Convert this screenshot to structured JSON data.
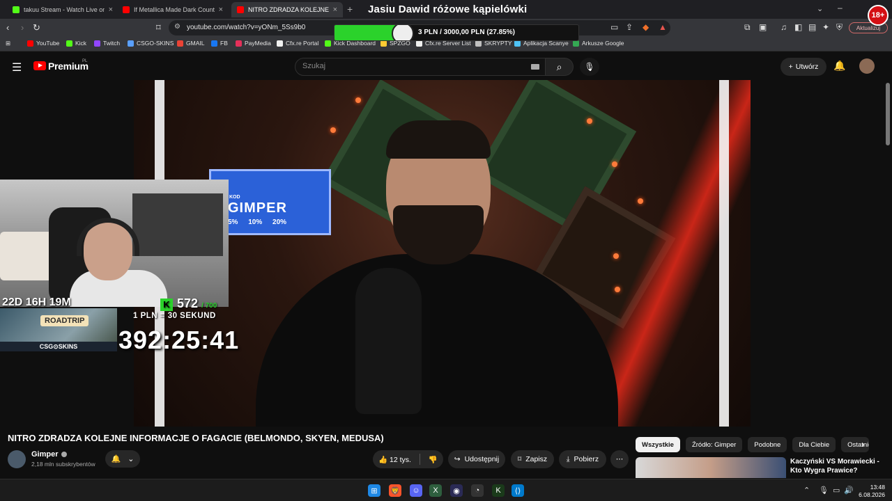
{
  "browser": {
    "tabs": [
      {
        "title": "takuu Stream - Watch Live on Kick",
        "active": false,
        "favicon_color": "#53fc18"
      },
      {
        "title": "If Metallica Made Dark Country (Sec",
        "active": false,
        "favicon_color": "#ff0000"
      },
      {
        "title": "NITRO ZDRADZA KOLEJNE IN",
        "active": true,
        "favicon_color": "#ff0000"
      }
    ],
    "new_tab": "+",
    "url": "youtube.com/watch?v=yONm_5Ss9b0",
    "update_button": "Aktualizuj",
    "bookmarks": [
      {
        "label": "YouTube",
        "color": "#ff0000"
      },
      {
        "label": "Kick",
        "color": "#53fc18"
      },
      {
        "label": "Twitch",
        "color": "#9146ff"
      },
      {
        "label": "CSGO-SKINS",
        "color": "#5aa0ff"
      },
      {
        "label": "GMAIL",
        "color": "#ea4335"
      },
      {
        "label": "FB",
        "color": "#1877f2"
      },
      {
        "label": "PayMedia",
        "color": "#e5305a"
      },
      {
        "label": "Cfx.re Portal",
        "color": "#f0f0f0"
      },
      {
        "label": "Kick Dashboard",
        "color": "#53fc18"
      },
      {
        "label": "SPZGO",
        "color": "#ffcc33"
      },
      {
        "label": "Cfx.re Server List",
        "color": "#f0f0f0"
      },
      {
        "label": "SKRYPTY",
        "color": "#c0c0c0"
      },
      {
        "label": "Aplikacja Scanye",
        "color": "#4fc3f7"
      },
      {
        "label": "Arkusze Google",
        "color": "#34a853"
      }
    ]
  },
  "stream_overlay": {
    "title": "Jasiu Dawid różowe kąpielówki",
    "donation_goal_label": "3 PLN / 3000,00 PLN  (27.85%)",
    "donation_progress": 0.2785,
    "subathon_timer": "22D 16H 19M",
    "kick_subs": "572",
    "kick_subs_max": "/ 700",
    "rate": "1 PLN  =  30 SEKUND",
    "big_timer": "392:25:41",
    "roadtrip_label": "ROADTRIP",
    "sponsor": "CSG⊙SKINS",
    "age_badge": "18+",
    "promo_small": "KOD",
    "promo_code": "GIMPER",
    "promo_pcts": "5% 10% 20%"
  },
  "youtube": {
    "brand": "Premium",
    "region": "PL",
    "search_placeholder": "Szukaj",
    "create_label": "Utwórz",
    "video_title": "NITRO ZDRADZA KOLEJNE INFORMACJE O FAGACIE (BELMONDO, SKYEN, MEDUSA)",
    "channel_name": "Gimper",
    "subscribers": "2,18 mln subskrybentów",
    "likes": "12 tys.",
    "share_label": "Udostępnij",
    "save_label": "Zapisz",
    "download_label": "Pobierz",
    "chips": [
      "Wszystkie",
      "Źródło: Gimper",
      "Podobne",
      "Dla Ciebie",
      "Ostatnio"
    ],
    "rec_title": "Kaczyński VS Morawiecki - Kto Wygra Prawice?"
  },
  "taskbar": {
    "time": "13:48",
    "date": "6.08.2026"
  }
}
